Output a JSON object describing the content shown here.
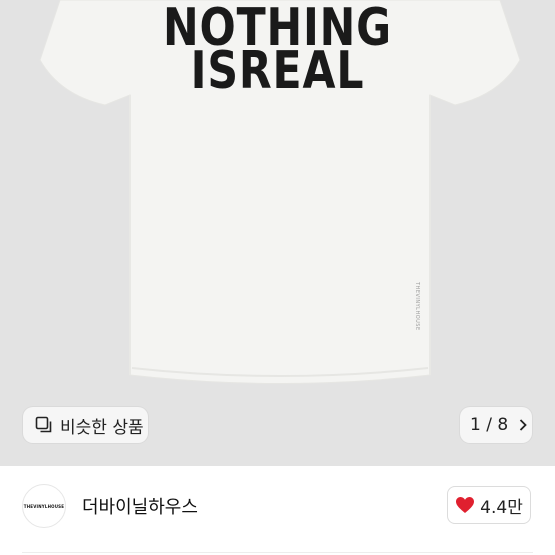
{
  "product_image": {
    "print_line_1": "NOTHING",
    "print_line_2": "ISREAL",
    "side_tag": "THEVINYLHOUSE",
    "shirt_color": "#f4f4f2",
    "background_color": "#e3e3e3"
  },
  "similar_button": {
    "label": "비슷한 상품",
    "icon": "similar-items-icon"
  },
  "image_counter": {
    "label": "1 / 8",
    "icon": "chevron-right-icon"
  },
  "seller": {
    "avatar_text": "THEVINYLHOUSE",
    "name": "더바이닐하우스"
  },
  "like": {
    "count": "4.4만",
    "icon": "heart-icon",
    "color": "#e0202f"
  }
}
